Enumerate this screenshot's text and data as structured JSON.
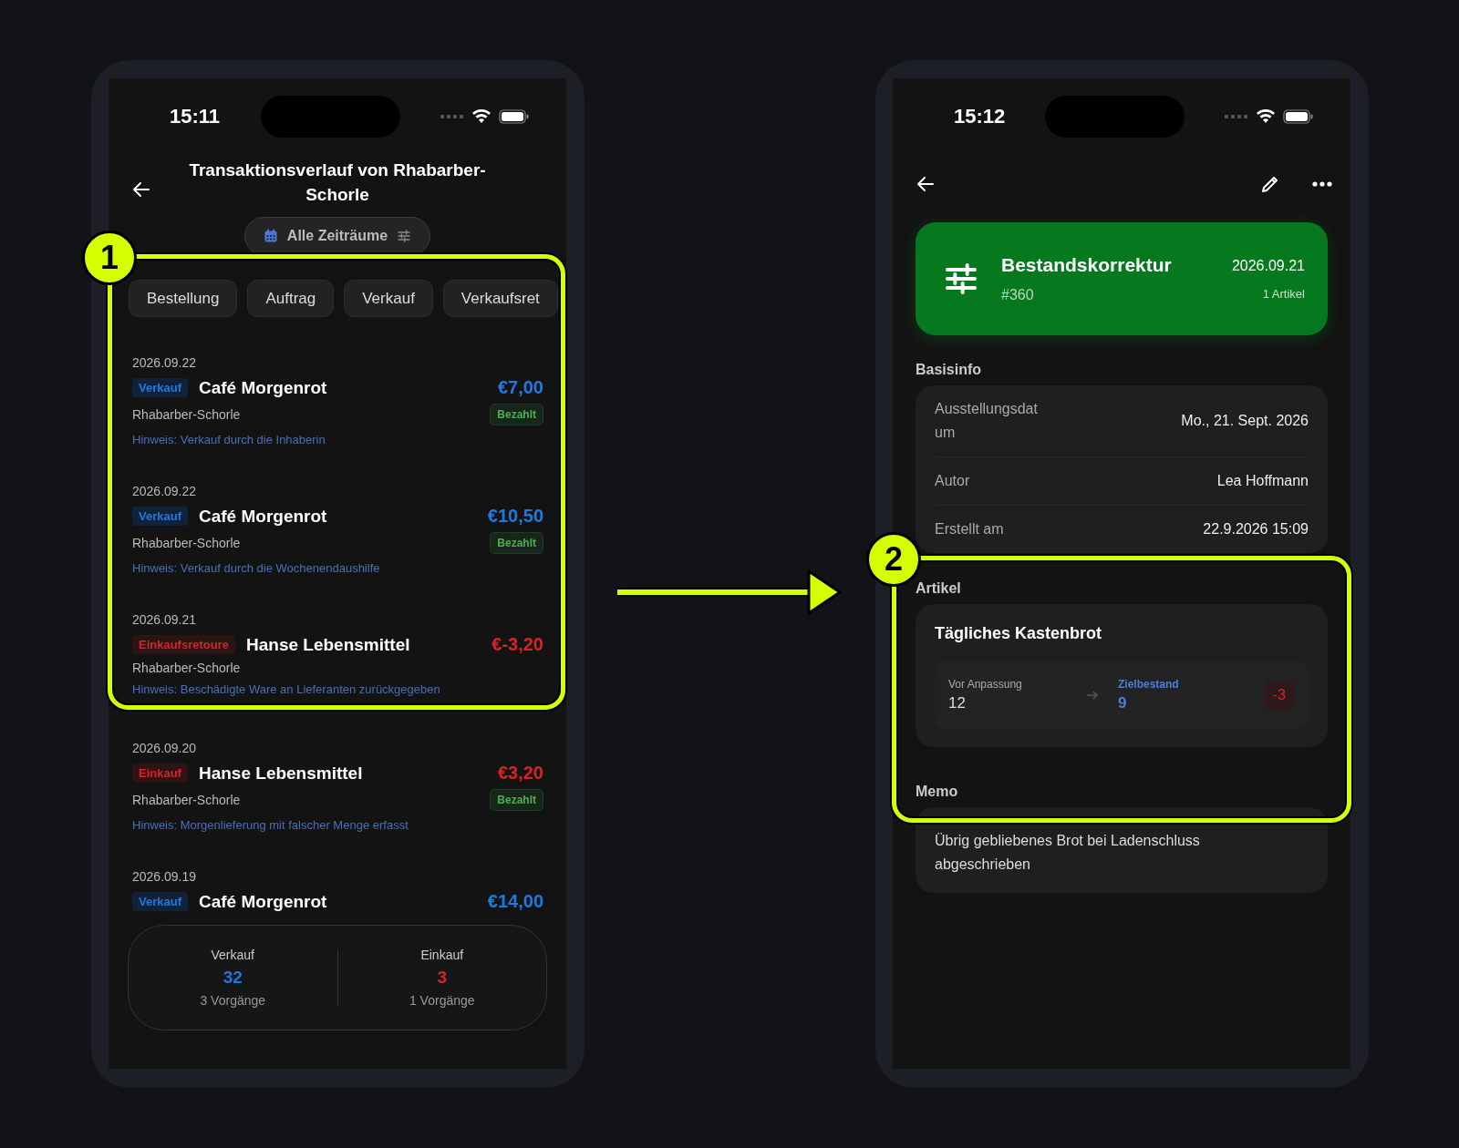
{
  "callouts": [
    {
      "number": "1"
    },
    {
      "number": "2"
    }
  ],
  "list_screen": {
    "status_bar": {
      "time": "15:11"
    },
    "title": "Transaktionsverlauf von Rhabarber-Schorle",
    "period_filter": "Alle Zeiträume",
    "filter_chips": [
      {
        "label": "Bestellung"
      },
      {
        "label": "Auftrag"
      },
      {
        "label": "Verkauf"
      },
      {
        "label": "Verkaufsret"
      }
    ],
    "transactions": [
      {
        "date": "2026.09.22",
        "kind": "sale",
        "type": "Verkauf",
        "partner": "Café Morgenrot",
        "amount": "€7,00",
        "product": "Rhabarber-Schorle",
        "status": "Bezahlt",
        "note": "Hinweis: Verkauf durch die Inhaberin"
      },
      {
        "date": "2026.09.22",
        "kind": "sale",
        "type": "Verkauf",
        "partner": "Café Morgenrot",
        "amount": "€10,50",
        "product": "Rhabarber-Schorle",
        "status": "Bezahlt",
        "note": "Hinweis: Verkauf durch die Wochenendaushilfe"
      },
      {
        "date": "2026.09.21",
        "kind": "purchase",
        "type": "Einkaufsretoure",
        "partner": "Hanse Lebensmittel",
        "amount": "€-3,20",
        "product": "Rhabarber-Schorle",
        "note": "Hinweis: Beschädigte Ware an Lieferanten zurückgegeben"
      },
      {
        "date": "2026.09.20",
        "kind": "purchase",
        "type": "Einkauf",
        "partner": "Hanse Lebensmittel",
        "amount": "€3,20",
        "product": "Rhabarber-Schorle",
        "status": "Bezahlt",
        "note": "Hinweis: Morgenlieferung mit falscher Menge erfasst"
      },
      {
        "date": "2026.09.19",
        "kind": "sale",
        "type": "Verkauf",
        "partner": "Café Morgenrot",
        "amount": "€14,00"
      }
    ],
    "summary": [
      {
        "kind": "sale",
        "label": "Verkauf",
        "value": "32",
        "count": "3 Vorgänge"
      },
      {
        "kind": "purchase",
        "label": "Einkauf",
        "value": "3",
        "count": "1 Vorgänge"
      }
    ]
  },
  "detail_screen": {
    "status_bar": {
      "time": "15:12"
    },
    "header": {
      "title": "Bestandskorrektur",
      "number": "#360",
      "date": "2026.09.21",
      "item_count": "1 Artikel"
    },
    "basisinfo": {
      "heading": "Basisinfo",
      "rows": [
        {
          "label": "Ausstellungsdatum",
          "value": "Mo., 21. Sept. 2026"
        },
        {
          "label": "Autor",
          "value": "Lea Hoffmann"
        },
        {
          "label": "Erstellt am",
          "value": "22.9.2026 15:09"
        }
      ]
    },
    "articles": {
      "heading": "Artikel",
      "items": [
        {
          "name": "Tägliches Kastenbrot",
          "before_label": "Vor Anpassung",
          "before": "12",
          "target_label": "Zielbestand",
          "target": "9",
          "difference": "-3"
        }
      ]
    },
    "memo": {
      "heading": "Memo",
      "text": "Übrig gebliebenes Brot bei Ladenschluss abgeschrieben"
    }
  }
}
